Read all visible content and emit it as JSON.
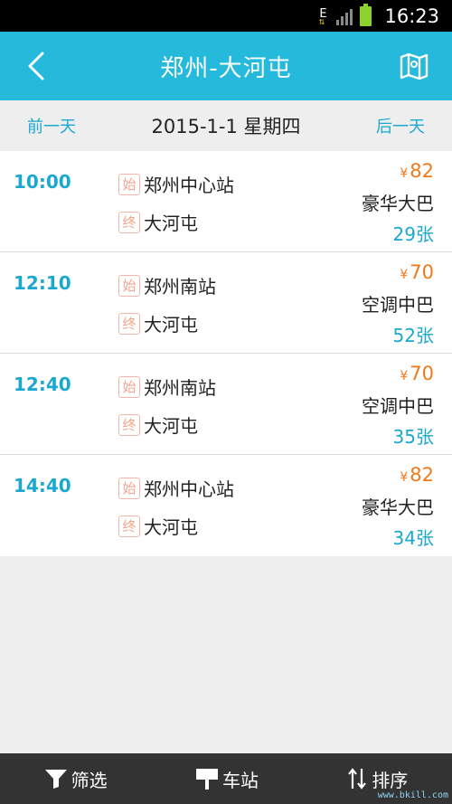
{
  "status_bar": {
    "network": "E",
    "time": "16:23"
  },
  "header": {
    "title": "郑州-大河屯"
  },
  "date_bar": {
    "prev_label": "前一天",
    "current_date": "2015-1-1 星期四",
    "next_label": "后一天"
  },
  "stop_tags": {
    "start": "始",
    "end": "终"
  },
  "currency_symbol": "¥",
  "trips": [
    {
      "time": "10:00",
      "start": "郑州中心站",
      "end": "大河屯",
      "price": "82",
      "bus_type": "豪华大巴",
      "seats": "29张"
    },
    {
      "time": "12:10",
      "start": "郑州南站",
      "end": "大河屯",
      "price": "70",
      "bus_type": "空调中巴",
      "seats": "52张"
    },
    {
      "time": "12:40",
      "start": "郑州南站",
      "end": "大河屯",
      "price": "70",
      "bus_type": "空调中巴",
      "seats": "35张"
    },
    {
      "time": "14:40",
      "start": "郑州中心站",
      "end": "大河屯",
      "price": "82",
      "bus_type": "豪华大巴",
      "seats": "34张"
    }
  ],
  "bottom_bar": {
    "filter_label": "筛选",
    "station_label": "车站",
    "sort_label": "排序"
  },
  "watermark": "www.bkill.com",
  "colors": {
    "header_bg": "#25b9db",
    "accent_blue": "#1aa8d0",
    "price_orange": "#f07a1a",
    "tag_pink": "#f3a58f",
    "bottom_bg": "#333333"
  }
}
